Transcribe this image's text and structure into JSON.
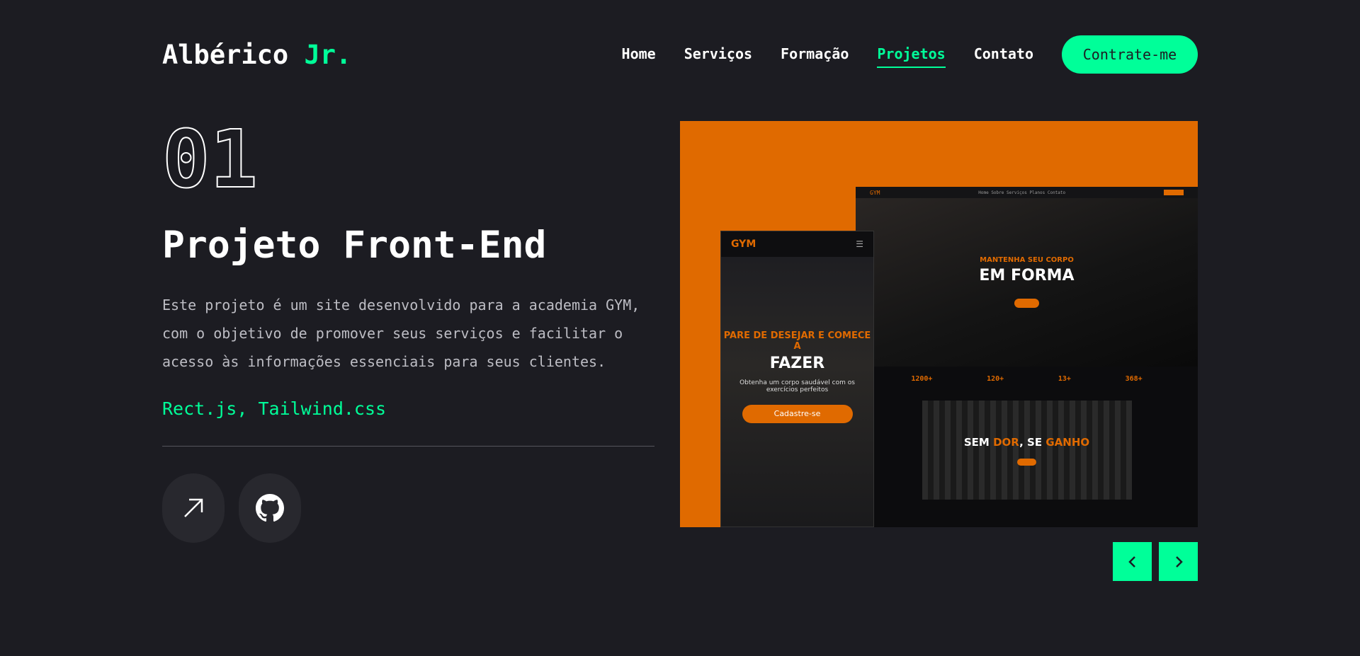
{
  "header": {
    "logo_name": "Albérico",
    "logo_accent": "Jr.",
    "nav": [
      "Home",
      "Serviços",
      "Formação",
      "Projetos",
      "Contato"
    ],
    "active_nav": "Projetos",
    "hire_button": "Contrate-me"
  },
  "project": {
    "number": "01",
    "title": "Projeto Front-End",
    "description": "Este projeto é um site desenvolvido para a academia GYM, com o objetivo de promover seus serviços e facilitar o acesso às informações essenciais para seus clientes.",
    "stack": "Rect.js, Tailwind.css",
    "actions": {
      "live_icon": "arrow-up-right-icon",
      "repo_icon": "github-icon"
    }
  },
  "preview": {
    "desktop": {
      "logo": "GYM",
      "nav_items": [
        "Home",
        "Sobre",
        "Serviços",
        "Planos",
        "Contato"
      ],
      "kicker": "MANTENHA SEU CORPO",
      "headline": "EM FORMA",
      "stats": [
        {
          "value": "1200+"
        },
        {
          "value": "120+"
        },
        {
          "value": "13+"
        },
        {
          "value": "368+"
        }
      ],
      "banner_prefix": "SEM",
      "banner_hl1": "DOR",
      "banner_mid": ", SE",
      "banner_hl2": "GANHO"
    },
    "mobile": {
      "logo": "GYM",
      "kicker": "PARE DE DESEJAR E COMECE A",
      "headline": "FAZER",
      "subtitle": "Obtenha um corpo saudável com os exercícios perfeitos",
      "button": "Cadastre-se"
    }
  },
  "slider": {
    "prev_icon": "chevron-left-icon",
    "next_icon": "chevron-right-icon"
  },
  "colors": {
    "background": "#1c1c22",
    "accent": "#00ff99",
    "preview_bg": "#e06a00"
  }
}
